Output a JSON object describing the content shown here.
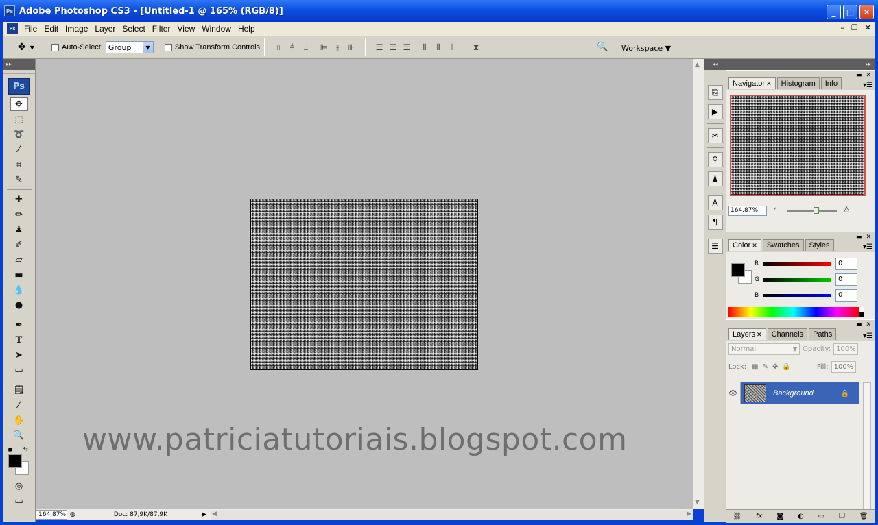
{
  "window": {
    "title": "Adobe Photoshop CS3 - [Untitled-1 @ 165% (RGB/8)]",
    "app_icon": "Ps",
    "controls": {
      "minimize": "_",
      "maximize": "□",
      "close": "✕"
    }
  },
  "menubar": {
    "items": [
      "File",
      "Edit",
      "Image",
      "Layer",
      "Select",
      "Filter",
      "View",
      "Window",
      "Help"
    ],
    "doc_controls": {
      "minimize": "–",
      "restore": "❐",
      "close": "✕"
    }
  },
  "options": {
    "auto_select_label": "Auto-Select:",
    "auto_select_value": "Group",
    "show_transform_label": "Show Transform Controls",
    "workspace_label": "Workspace ▼"
  },
  "toolbox": {
    "logo": "Ps",
    "tools": [
      "move",
      "marquee",
      "lasso",
      "magic-wand",
      "crop",
      "slice",
      "healing",
      "brush",
      "clone-stamp",
      "history-brush",
      "eraser",
      "gradient",
      "blur",
      "dodge",
      "pen",
      "type",
      "path-select",
      "shape",
      "notes",
      "eyedropper",
      "hand",
      "zoom"
    ]
  },
  "canvas": {
    "watermark": "www.patriciatutoriais.blogspot.com"
  },
  "statusbar": {
    "zoom": "164,87%",
    "doc": "Doc: 87,9K/87,9K"
  },
  "navigator": {
    "tabs": [
      "Navigator",
      "Histogram",
      "Info"
    ],
    "zoom": "164.87%"
  },
  "color": {
    "tabs": [
      "Color",
      "Swatches",
      "Styles"
    ],
    "channels": [
      {
        "label": "R",
        "value": "0",
        "color": "#ff0000"
      },
      {
        "label": "G",
        "value": "0",
        "color": "#00c000"
      },
      {
        "label": "B",
        "value": "0",
        "color": "#0000ff"
      }
    ]
  },
  "layers": {
    "tabs": [
      "Layers",
      "Channels",
      "Paths"
    ],
    "blend_mode": "Normal",
    "opacity_label": "Opacity:",
    "opacity_value": "100%",
    "lock_label": "Lock:",
    "fill_label": "Fill:",
    "fill_value": "100%",
    "items": [
      {
        "name": "Background",
        "locked": true,
        "visible": true
      }
    ]
  }
}
